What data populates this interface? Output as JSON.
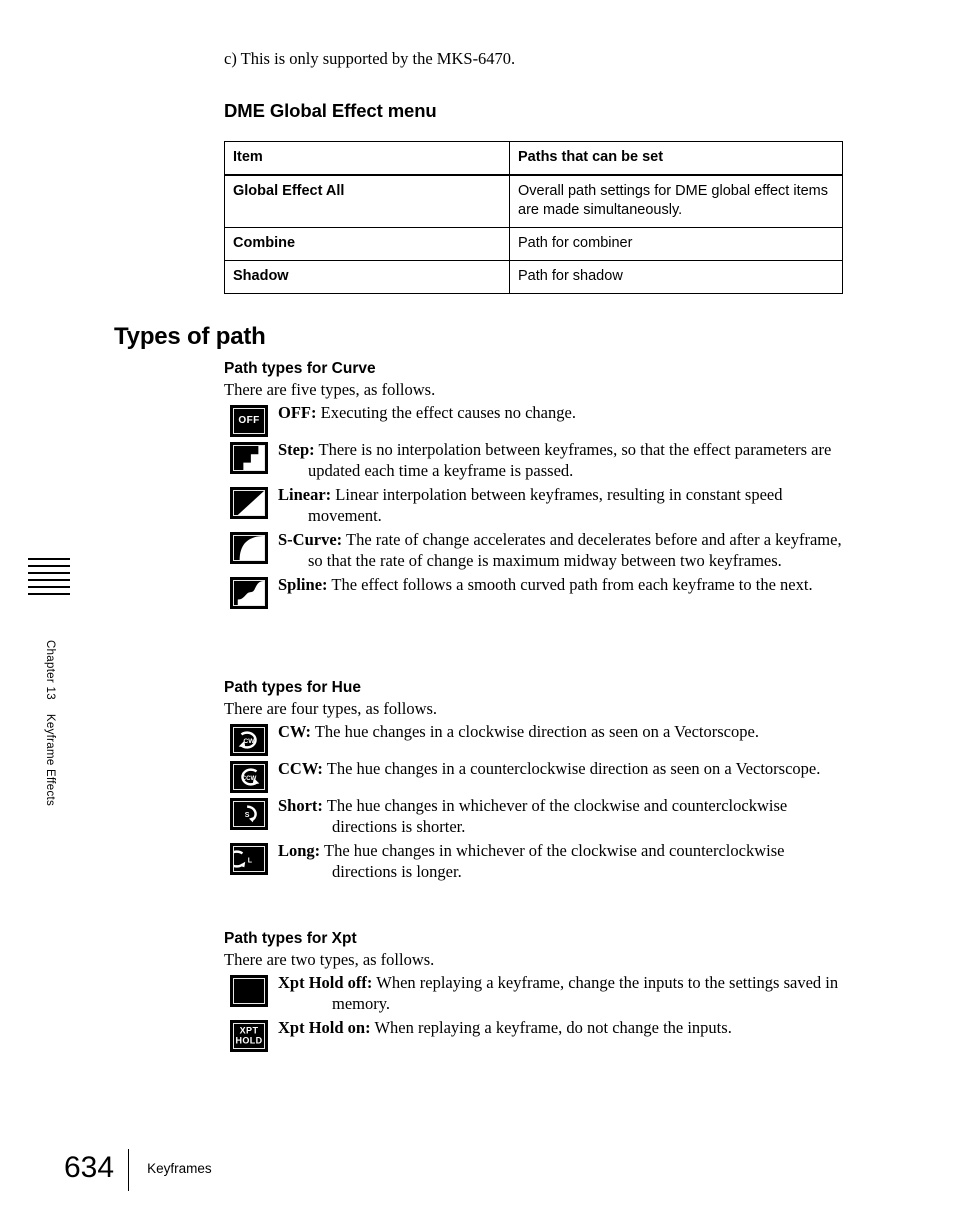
{
  "sidebar": {
    "chapter": "Chapter 13",
    "section": "Keyframe Effects",
    "tab_rule_count": 6
  },
  "note": "c) This is only supported by the MKS-6470.",
  "dme_menu": {
    "heading": "DME Global Effect menu",
    "columns": [
      "Item",
      "Paths that can be set"
    ],
    "rows": [
      [
        "Global Effect All",
        "Overall path settings for DME global effect items are made simultaneously."
      ],
      [
        "Combine",
        "Path for combiner"
      ],
      [
        "Shadow",
        "Path for shadow"
      ]
    ]
  },
  "section_heading": "Types of path",
  "curve": {
    "heading": "Path types for Curve",
    "intro": "There are five types, as follows.",
    "items": [
      {
        "icon": "off-icon",
        "icon_text": "OFF",
        "lead": "OFF:",
        "body": "Executing the effect causes no change."
      },
      {
        "icon": "step-curve-icon",
        "icon_text": "",
        "lead": "Step:",
        "body": "There is no interpolation between keyframes, so that the effect parameters are updated each time a keyframe is passed."
      },
      {
        "icon": "linear-curve-icon",
        "icon_text": "",
        "lead": "Linear:",
        "body": "Linear interpolation between keyframes, resulting in constant speed movement."
      },
      {
        "icon": "s-curve-icon",
        "icon_text": "",
        "lead": "S-Curve:",
        "body": "The rate of change accelerates and decelerates before and after a keyframe, so that the rate of change is maximum midway between two keyframes."
      },
      {
        "icon": "spline-curve-icon",
        "icon_text": "",
        "lead": "Spline:",
        "body": "The effect follows a smooth curved path from each keyframe to the next."
      }
    ]
  },
  "hue": {
    "heading": "Path types for Hue",
    "intro": "There are four types, as follows.",
    "items": [
      {
        "icon": "cw-icon",
        "icon_text": "CW",
        "lead": "CW:",
        "body": "The hue changes in a clockwise direction as seen on a Vectorscope."
      },
      {
        "icon": "ccw-icon",
        "icon_text": "CCW",
        "lead": "CCW:",
        "body": "The hue changes in a counterclockwise direction as seen on a Vectorscope."
      },
      {
        "icon": "short-hue-icon",
        "icon_text": "S",
        "lead": "Short:",
        "body": "The hue changes in whichever of the clockwise and counterclockwise directions is shorter."
      },
      {
        "icon": "long-hue-icon",
        "icon_text": "L",
        "lead": "Long:",
        "body": "The hue changes in whichever of the clockwise and counterclockwise directions is longer."
      }
    ]
  },
  "xpt": {
    "heading": "Path types for Xpt",
    "intro": "There are two types, as follows.",
    "items": [
      {
        "icon": "xpt-hold-off-icon",
        "icon_text": "",
        "lead": "Xpt Hold off:",
        "body": "When replaying a keyframe, change the inputs to the settings saved in memory."
      },
      {
        "icon": "xpt-hold-on-icon",
        "icon_text_1": "XPT",
        "icon_text_2": "HOLD",
        "lead": "Xpt Hold on:",
        "body": "When replaying a keyframe, do not change the inputs."
      }
    ]
  },
  "footer": {
    "page_number": "634",
    "label": "Keyframes"
  },
  "colors": {
    "ink": "#000000",
    "paper": "#ffffff",
    "icon_fill": "#ffffff",
    "icon_bg": "#000000"
  }
}
